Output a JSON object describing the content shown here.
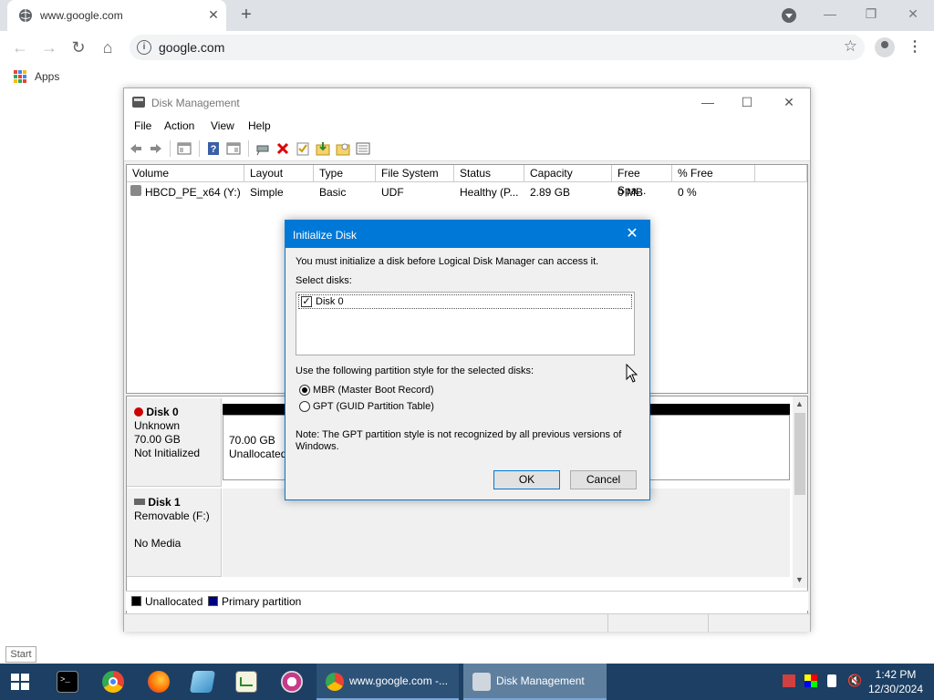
{
  "browser": {
    "tab_title": "www.google.com",
    "new_tab_symbol": "+",
    "url": "google.com",
    "bookmarks": [
      {
        "label": "Apps",
        "icon": "apps-grid-icon"
      }
    ]
  },
  "disk_management": {
    "title": "Disk Management",
    "menu": [
      "File",
      "Action",
      "View",
      "Help"
    ],
    "toolbar_icons": [
      "back-icon",
      "forward-icon",
      "console-tree-icon",
      "help-icon",
      "properties-icon",
      "connect-icon",
      "delete-icon",
      "check-icon",
      "import-icon",
      "open-icon",
      "details-icon"
    ],
    "columns": [
      "Volume",
      "Layout",
      "Type",
      "File System",
      "Status",
      "Capacity",
      "Free Spa...",
      "% Free"
    ],
    "volumes": [
      {
        "volume": "HBCD_PE_x64 (Y:)",
        "layout": "Simple",
        "type": "Basic",
        "file_system": "UDF",
        "status": "Healthy (P...",
        "capacity": "2.89 GB",
        "free": "0 MB",
        "pct_free": "0 %"
      }
    ],
    "disks": [
      {
        "name": "Disk 0",
        "line1": "Unknown",
        "line2": "70.00 GB",
        "line3": "Not Initialized",
        "partition_size": "70.00 GB",
        "partition_label": "Unallocated"
      },
      {
        "name": "Disk 1",
        "line1": "Removable (F:)",
        "line2": "",
        "line3": "No Media"
      }
    ],
    "legend": [
      {
        "label": "Unallocated",
        "color": "#000000"
      },
      {
        "label": "Primary partition",
        "color": "#000080"
      }
    ]
  },
  "dialog": {
    "title": "Initialize Disk",
    "close_symbol": "✕",
    "message": "You must initialize a disk before Logical Disk Manager can access it.",
    "select_label": "Select disks:",
    "disk_item": "Disk 0",
    "disk_checked": true,
    "style_label": "Use the following partition style for the selected disks:",
    "options": [
      {
        "label": "MBR (Master Boot Record)",
        "selected": true
      },
      {
        "label": "GPT (GUID Partition Table)",
        "selected": false
      }
    ],
    "note": "Note: The GPT partition style is not recognized by all previous versions of Windows.",
    "ok_label": "OK",
    "cancel_label": "Cancel"
  },
  "taskbar": {
    "start_tooltip": "Start",
    "tasks": [
      {
        "label": "www.google.com -...",
        "icon": "chrome-icon"
      },
      {
        "label": "Disk Management",
        "icon": "disk-management-icon"
      }
    ],
    "time": "1:42 PM",
    "date": "12/30/2024"
  }
}
